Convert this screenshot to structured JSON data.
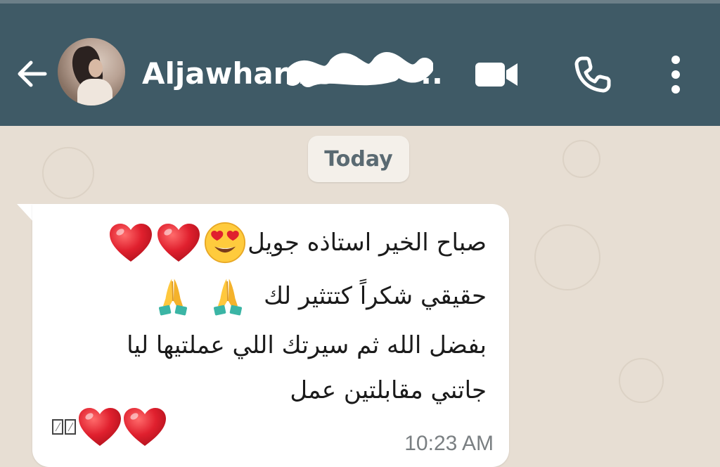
{
  "header": {
    "contact_name": "Aljawhara",
    "truncation": "..",
    "back_icon": "arrow-left-icon",
    "avatar": "contact-avatar",
    "actions": [
      "video-call-icon",
      "phone-icon",
      "more-vert-icon"
    ],
    "header_color": "#3f5a66"
  },
  "chat": {
    "date_divider": "Today",
    "background_color": "#e7ded3",
    "message": {
      "line1": "صباح الخير استاذه جويل",
      "line2": "حقيقي شكراً كتتثير لك",
      "line3": "بفضل الله ثم سيرتك اللي عملتيها ليا",
      "line4": "جاتني مقابلتين عمل",
      "emoji_line1": [
        "heart-eyes-icon",
        "red-heart-icon",
        "red-heart-icon"
      ],
      "emoji_line2": [
        "folded-hands-icon",
        "folded-hands-icon"
      ],
      "emoji_line5": [
        "missing-glyph-icon",
        "missing-glyph-icon",
        "red-heart-icon",
        "red-heart-icon"
      ],
      "time": "10:23 AM"
    }
  }
}
